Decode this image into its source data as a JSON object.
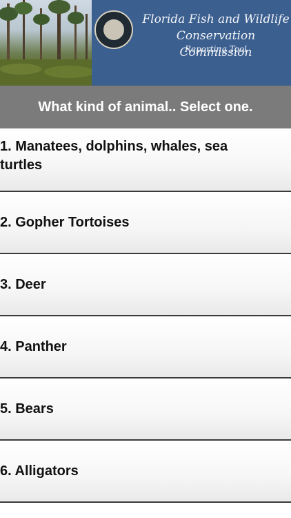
{
  "header": {
    "title_line1": "Florida Fish and Wildlife",
    "title_line2": "Conservation Commission",
    "subtitle": "Reporting Tool"
  },
  "question": "What kind of animal.. Select one.",
  "options": [
    {
      "label": "1. Manatees, dolphins, whales, sea turtles"
    },
    {
      "label": "2. Gopher Tortoises"
    },
    {
      "label": "3. Deer"
    },
    {
      "label": "4. Panther"
    },
    {
      "label": "5. Bears"
    },
    {
      "label": "6. Alligators"
    }
  ],
  "colors": {
    "banner_blue": "#3b5f8f",
    "question_bar": "#7b7b7b",
    "divider": "#3a3a3a"
  }
}
